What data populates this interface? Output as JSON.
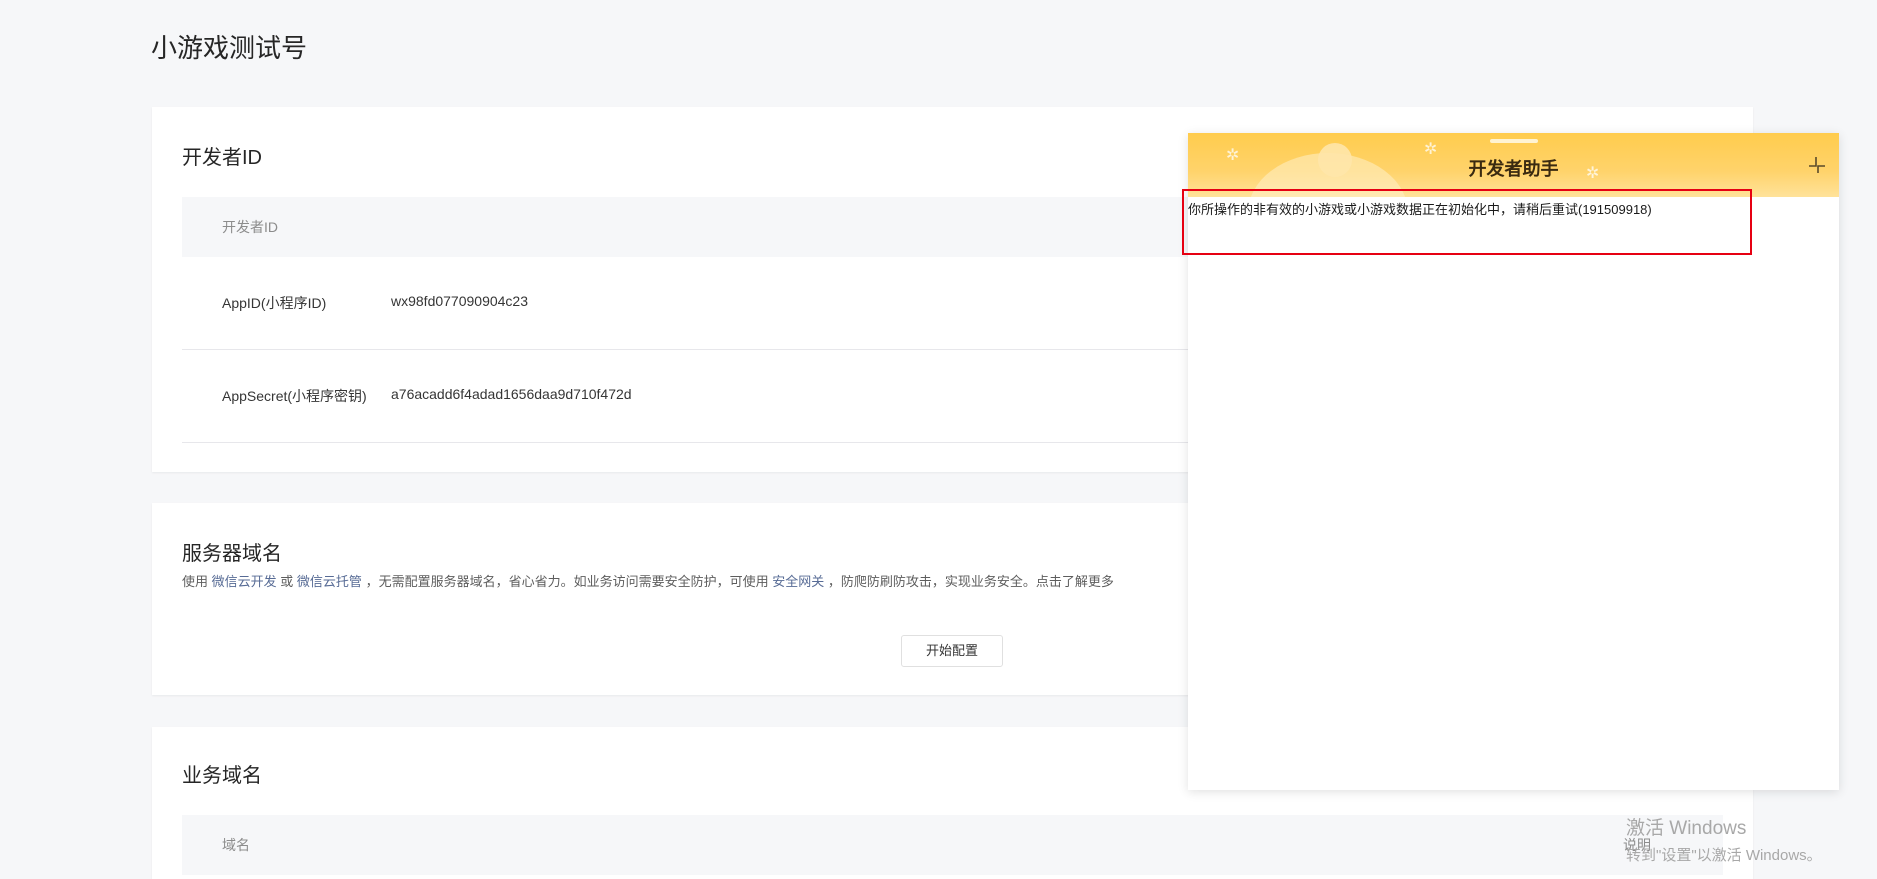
{
  "page": {
    "title": "小游戏测试号"
  },
  "developer_card": {
    "title": "开发者ID",
    "table_header": "开发者ID",
    "rows": [
      {
        "label": "AppID(小程序ID)",
        "value": "wx98fd077090904c23"
      },
      {
        "label": "AppSecret(小程序密钥)",
        "value": "a76acadd6f4adad1656daa9d710f472d"
      }
    ]
  },
  "server_card": {
    "title": "服务器域名",
    "desc_prefix": "使用",
    "link1": "微信云开发",
    "desc_or": "或",
    "link2": "微信云托管",
    "desc_mid": "，无需配置服务器域名，省心省力。如业务访问需要安全防护，可使用",
    "link3": "安全网关",
    "desc_suffix": "，防爬防刷防攻击，实现业务安全。点击了解更多",
    "button": "开始配置"
  },
  "business_card": {
    "title": "业务域名",
    "header_col1": "域名",
    "header_col2": "说明"
  },
  "assistant": {
    "title": "开发者助手",
    "message": "你所操作的非有效的小游戏或小游戏数据正在初始化中，请稍后重试(191509918)"
  },
  "watermark": {
    "line1": "激活 Windows",
    "line2": "转到\"设置\"以激活 Windows。"
  },
  "colors": {
    "link": "#576b95",
    "highlight": "#e60012",
    "assistant_header": "#ffcc4d"
  }
}
